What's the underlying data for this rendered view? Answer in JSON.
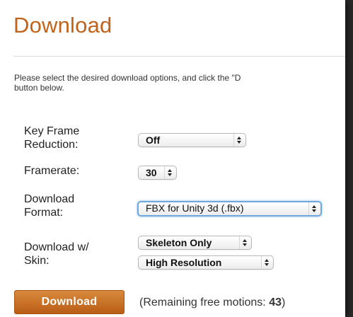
{
  "page": {
    "title": "Download",
    "instructions_line1": "Please select the desired download options, and click the \"D",
    "instructions_line2": "button below."
  },
  "options": {
    "key_frame_reduction": {
      "label_line1": "Key Frame",
      "label_line2": "Reduction:",
      "value": "Off"
    },
    "framerate": {
      "label": "Framerate:",
      "value": "30"
    },
    "download_format": {
      "label_line1": "Download",
      "label_line2": "Format:",
      "value": "FBX for Unity 3d (.fbx)"
    },
    "download_with_skin": {
      "label_line1": "Download w/",
      "label_line2": "Skin:",
      "skin_value": "Skeleton Only",
      "resolution_value": "High Resolution"
    }
  },
  "actions": {
    "download_label": "Download",
    "remaining_prefix": "(Remaining free motions: ",
    "remaining_count": "43",
    "remaining_suffix": ")"
  },
  "colors": {
    "accent": "#c1631b",
    "button_top": "#d98a3c",
    "button_bottom": "#b85d16",
    "focus_ring": "#6fa8de"
  },
  "icons": {
    "select_arrows": "updown-arrows-icon"
  }
}
